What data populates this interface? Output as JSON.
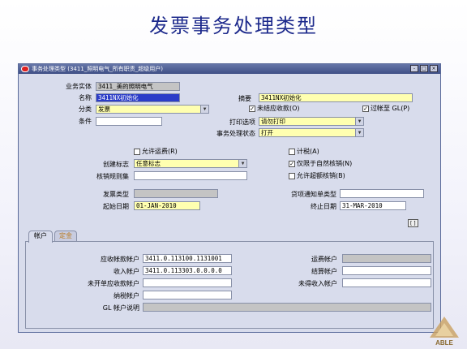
{
  "slide_title": "发票事务处理类型",
  "window": {
    "title": "事务处理类型 (3411_照明电气_所有职责_超级用户)",
    "buttons": [
      "-",
      "□",
      "×"
    ]
  },
  "form": {
    "business_entity": {
      "label": "业务实体",
      "value": "3411_美的照明电气"
    },
    "name": {
      "label": "名称",
      "value": "3411NX初始化"
    },
    "description": {
      "label": "摘要",
      "value": "3411NX初始化"
    },
    "class": {
      "label": "分类",
      "value": "发票"
    },
    "terms": {
      "label": "条件",
      "value": ""
    },
    "open_receivable": {
      "label": "未结应收款(O)",
      "checked": true
    },
    "post_to_gl": {
      "label": "过帐至 GL(P)",
      "checked": true
    },
    "print_option": {
      "label": "打印选项",
      "value": "请勿打印"
    },
    "transaction_status": {
      "label": "事务处理状态",
      "value": "打开"
    },
    "allow_freight": {
      "label": "允许运费(R)",
      "checked": false
    },
    "tax": {
      "label": "计税(A)",
      "checked": false
    },
    "creation_sign": {
      "label": "创建标志",
      "value": "任意标志"
    },
    "natural_application_only": {
      "label": "仅限于自然核销(N)",
      "checked": true
    },
    "allow_overapplication": {
      "label": "允许超额核销(B)",
      "checked": false
    },
    "application_rule_set": {
      "label": "核销规则集",
      "value": ""
    },
    "invoice_type": {
      "label": "发票类型",
      "value": ""
    },
    "credit_memo_type": {
      "label": "贷项通知单类型",
      "value": ""
    },
    "start_date": {
      "label": "起始日期",
      "value": "01-JAN-2010"
    },
    "end_date": {
      "label": "终止日期",
      "value": "31-MAR-2010"
    },
    "bracket_button": "[ ]"
  },
  "tabs": [
    {
      "label": "帐户",
      "active": true
    },
    {
      "label": "定金",
      "active": false
    }
  ],
  "accounts": {
    "receivable": {
      "label": "应收帐款帐户",
      "value": "3411.0.113100.1131001"
    },
    "revenue": {
      "label": "收入帐户",
      "value": "3411.0.113303.0.0.0.0"
    },
    "unbilled_receivable": {
      "label": "未开单应收款帐户",
      "value": ""
    },
    "tax": {
      "label": "纳税帐户",
      "value": ""
    },
    "gl_description": {
      "label": "GL 帐户说明",
      "value": ""
    },
    "freight": {
      "label": "运费帐户",
      "value": ""
    },
    "clearing": {
      "label": "结算帐户",
      "value": ""
    },
    "unearned_revenue": {
      "label": "未得收入帐户",
      "value": ""
    }
  },
  "logo_text": "ABLE",
  "colors": {
    "title": "#1d2a8c",
    "titlebar": "#3f4f86",
    "window_bg": "#d8dcec",
    "required_field": "#ffffb0",
    "readonly_field": "#c4c4c4",
    "selected_field": "#2b3cc8"
  }
}
